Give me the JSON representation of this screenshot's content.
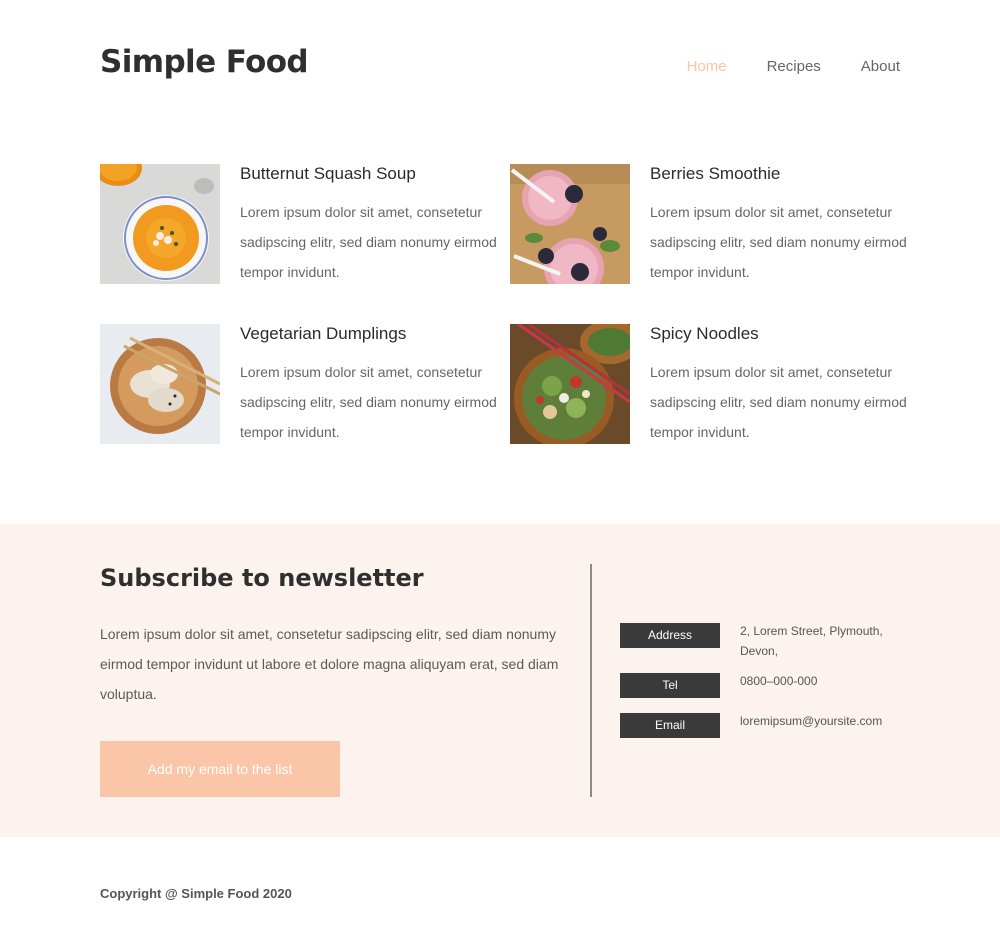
{
  "brand": {
    "name": "Simple Food"
  },
  "nav": {
    "items": [
      "Home",
      "Recipes",
      "About"
    ],
    "active": "Home"
  },
  "colors": {
    "accent": "#fbc5a7",
    "nav_active": "#f9c5a8",
    "section_bg": "#fcf3ee",
    "label_bg": "#3a3a3a"
  },
  "recipes": [
    {
      "title": "Butternut Squash Soup",
      "description": "Lorem ipsum dolor sit amet, consetetur sadipscing elitr, sed diam nonumy eirmod tempor invidunt."
    },
    {
      "title": "Berries Smoothie",
      "description": "Lorem ipsum dolor sit amet, consetetur sadipscing elitr, sed diam nonumy eirmod tempor invidunt."
    },
    {
      "title": "Vegetarian Dumplings",
      "description": "Lorem ipsum dolor sit amet, consetetur sadipscing elitr, sed diam nonumy eirmod tempor invidunt."
    },
    {
      "title": "Spicy Noodles",
      "description": "Lorem ipsum dolor sit amet, consetetur sadipscing elitr, sed diam nonumy eirmod tempor invidunt."
    }
  ],
  "newsletter": {
    "title": "Subscribe to newsletter",
    "text": "Lorem ipsum dolor sit amet, consetetur sadipscing elitr, sed diam nonumy eirmod tempor invidunt ut labore et dolore magna aliquyam erat, sed diam voluptua.",
    "button_label": "Add my email to the list"
  },
  "contact": {
    "address_label": "Address",
    "address_value": "2, Lorem Street, Plymouth, Devon,",
    "tel_label": "Tel",
    "tel_value": "0800–000-000",
    "email_label": "Email",
    "email_value": "loremipsum@yoursite.com"
  },
  "footer": {
    "copyright": "Copyright @ Simple Food 2020"
  }
}
